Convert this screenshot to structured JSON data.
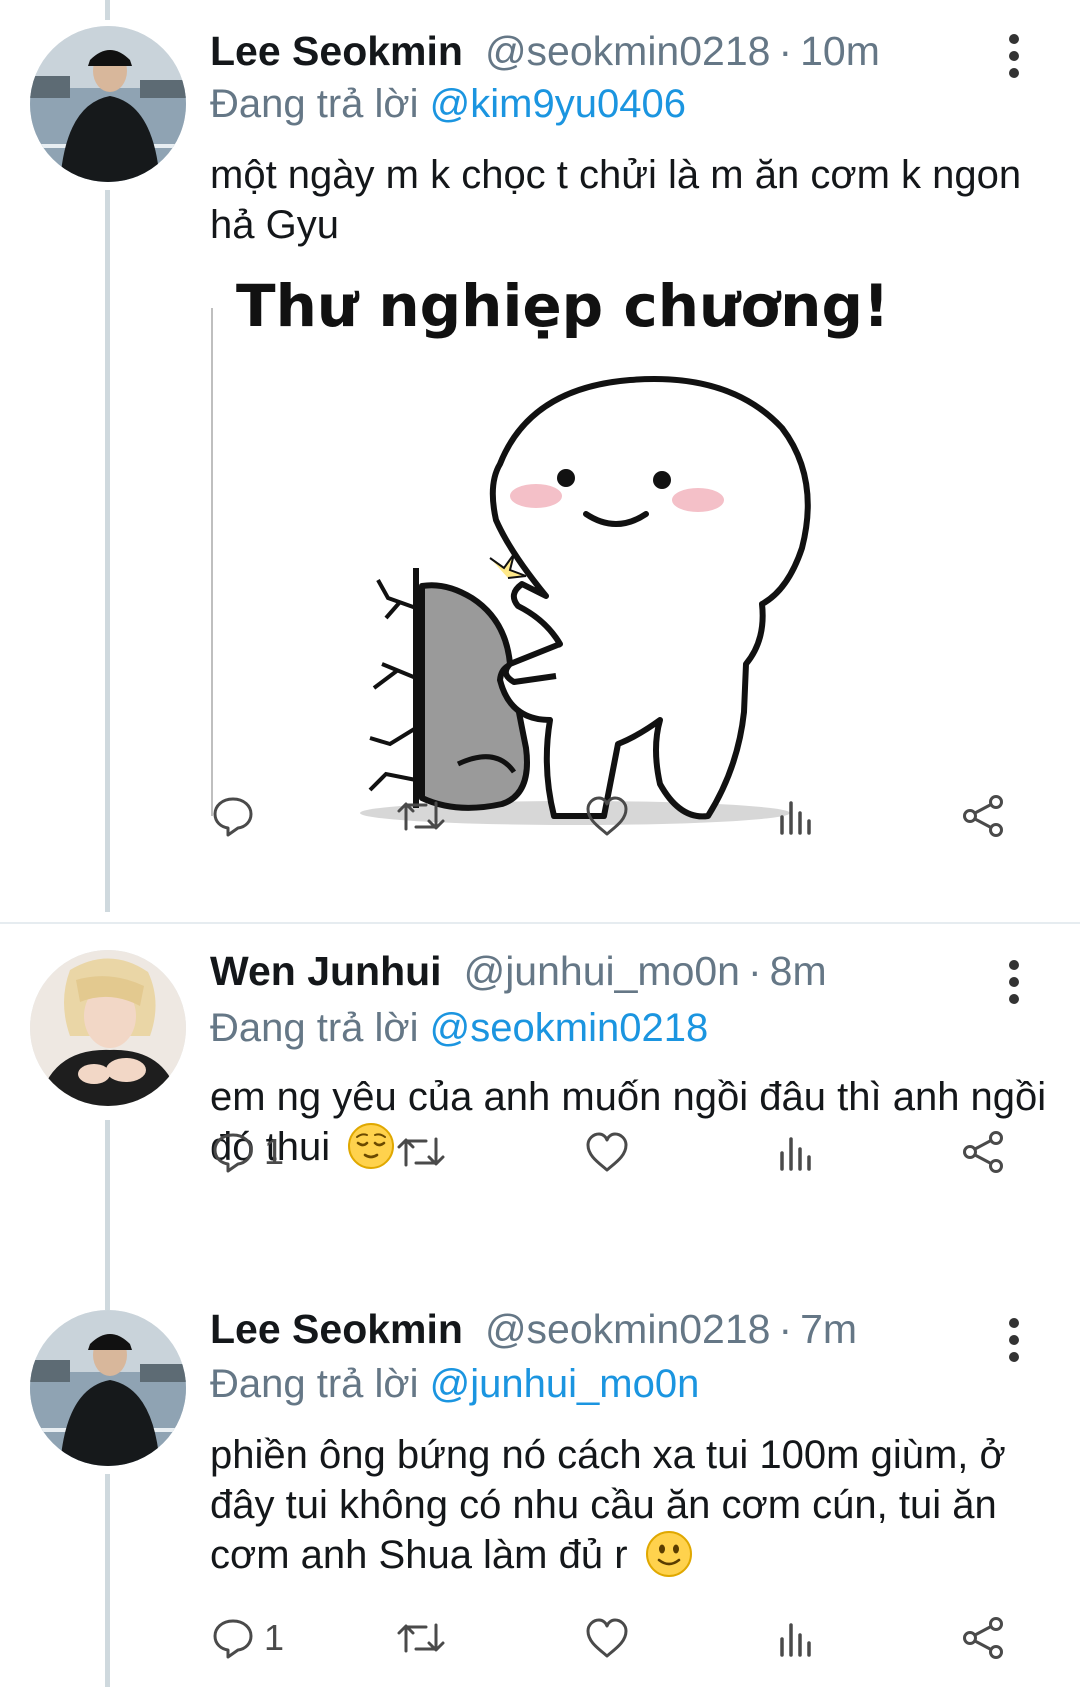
{
  "tweets": [
    {
      "name": "Lee Seokmin",
      "handle": "@seokmin0218",
      "sep": "·",
      "time": "10m",
      "reply_prefix": "Đang trả lời ",
      "reply_to": "@kim9yu0406",
      "text": "một ngày m k chọc t chửi là m ăn cơm k ngon hả Gyu",
      "media": {
        "caption": "Thư nghiẹp chương!"
      },
      "actions": {
        "reply_count": "",
        "retweet_count": "",
        "like_count": ""
      }
    },
    {
      "name": "Wen Junhui",
      "handle": "@junhui_mo0n",
      "sep": "·",
      "time": "8m",
      "reply_prefix": "Đang trả lời ",
      "reply_to": "@seokmin0218",
      "text": "em ng yêu của anh muốn ngồi đâu thì anh ngồi đó thui",
      "emoji": "relieved-face",
      "actions": {
        "reply_count": "1",
        "retweet_count": "",
        "like_count": ""
      }
    },
    {
      "name": "Lee Seokmin",
      "handle": "@seokmin0218",
      "sep": "·",
      "time": "7m",
      "reply_prefix": "Đang trả lời ",
      "reply_to": "@junhui_mo0n",
      "text": "phiền ông bứng nó cách xa tui 100m giùm, ở đây tui không có nhu cầu ăn cơm cún, tui ăn cơm anh Shua làm đủ r",
      "emoji": "slightly-smiling-face",
      "actions": {
        "reply_count": "1",
        "retweet_count": "",
        "like_count": ""
      }
    }
  ],
  "icons": [
    "reply-icon",
    "retweet-icon",
    "like-icon",
    "analytics-icon",
    "share-icon",
    "more-options-icon"
  ],
  "colors": {
    "mention": "#1b95e0",
    "secondary": "#657786",
    "thread_line": "#cfd9de",
    "text": "#14171a"
  }
}
